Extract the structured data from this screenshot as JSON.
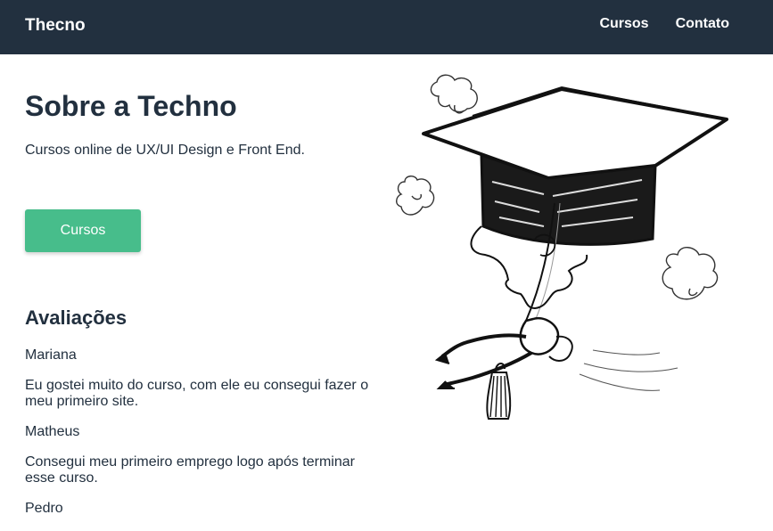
{
  "header": {
    "brand": "Thecno",
    "nav": [
      "Cursos",
      "Contato"
    ]
  },
  "hero": {
    "title": "Sobre a Techno",
    "subtitle": "Cursos online de UX/UI Design e Front End.",
    "button_label": "Cursos"
  },
  "reviews": {
    "title": "Avaliações",
    "items": [
      {
        "name": "Mariana",
        "text": "Eu gostei muito do curso, com ele eu consegui fazer o meu primeiro site."
      },
      {
        "name": "Matheus",
        "text": "Consegui meu primeiro emprego logo após terminar esse curso."
      },
      {
        "name": "Pedro"
      }
    ]
  },
  "colors": {
    "header_bg": "#22303f",
    "text": "#22303f",
    "accent": "#47bd8b"
  },
  "icons": [
    "graduation-cap-illustration",
    "cloud-icon"
  ]
}
